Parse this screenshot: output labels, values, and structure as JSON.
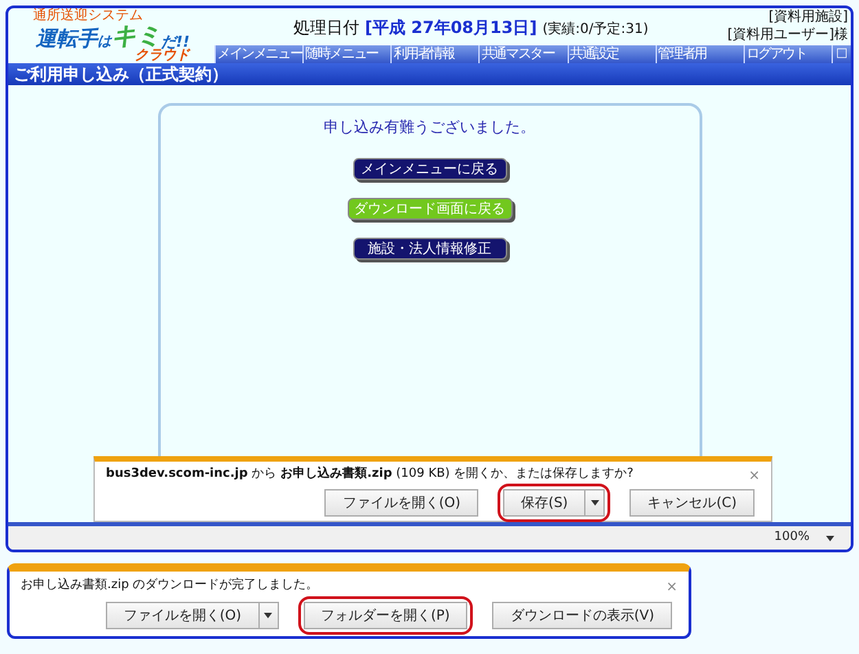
{
  "logo": {
    "subtitle": "通所送迎システム",
    "parts": [
      "運転手",
      "は",
      "キミ",
      "だ!!",
      "クラウド"
    ]
  },
  "header": {
    "date_label": "処理日付",
    "date": "[平成 27年08月13日]",
    "counts": "(実績:0/予定:31)",
    "facility": "[資料用施設]",
    "user": "[資料用ユーザー]様"
  },
  "nav": {
    "items": [
      "メインメニュー",
      "随時メニュー",
      "利用者情報",
      "共通マスター",
      "共通設定",
      "管理者用",
      "ログアウト"
    ],
    "toggle": "□"
  },
  "page_title": "ご利用申し込み（正式契約）",
  "message": "申し込み有難うございました。",
  "buttons": [
    {
      "label": "メインメニューに戻る",
      "kind": "navy"
    },
    {
      "label": "ダウンロード画面に戻る",
      "kind": "green"
    },
    {
      "label": "施設・法人情報修正",
      "kind": "navy"
    }
  ],
  "status_bar": {
    "zoom": "100%"
  },
  "download_prompt": {
    "host": "bus3dev.scom-inc.jp",
    "from": "から",
    "file": "お申し込み書類.zip",
    "size": "(109 KB)",
    "question": "を開くか、または保存しますか?",
    "close": "×",
    "buttons": [
      {
        "label": "ファイルを開く(O)",
        "split": false,
        "highlighted": false
      },
      {
        "label": "保存(S)",
        "split": true,
        "highlighted": true
      },
      {
        "label": "キャンセル(C)",
        "split": false,
        "highlighted": false
      }
    ]
  },
  "download_done": {
    "message": "お申し込み書類.zip のダウンロードが完了しました。",
    "close": "×",
    "buttons": [
      {
        "label": "ファイルを開く(O)",
        "split": true,
        "highlighted": false
      },
      {
        "label": "フォルダーを開く(P)",
        "split": false,
        "highlighted": true
      },
      {
        "label": "ダウンロードの表示(V)",
        "split": false,
        "highlighted": false
      }
    ]
  }
}
